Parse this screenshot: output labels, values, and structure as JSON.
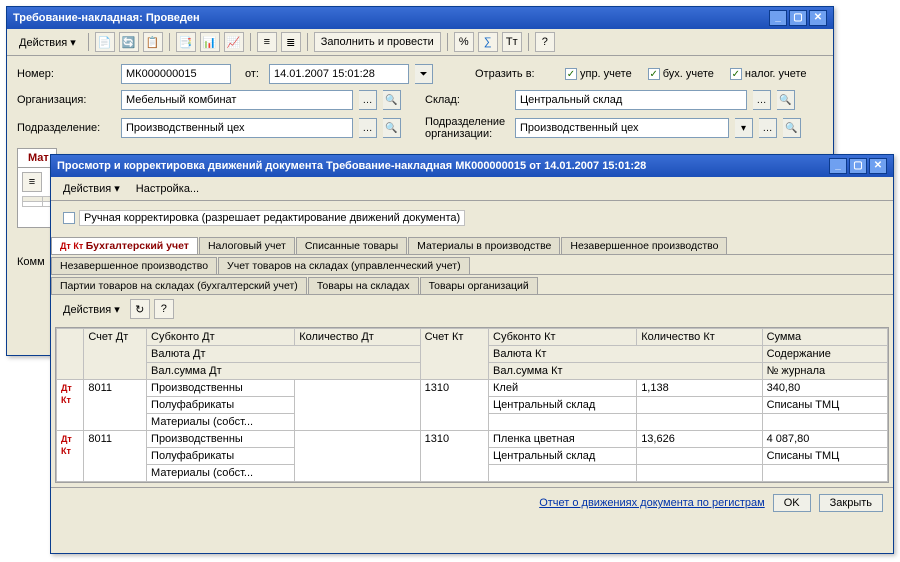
{
  "win1": {
    "title": "Требование-накладная: Проведен",
    "menu_actions": "Действия ▾",
    "btn_fill": "Заполнить и провести",
    "form": {
      "number_label": "Номер:",
      "number_value": "МК000000015",
      "from_label": "от:",
      "date_value": "14.01.2007 15:01:28",
      "org_label": "Организация:",
      "org_value": "Мебельный комбинат",
      "podr_label": "Подразделение:",
      "podr_value": "Производственный цех",
      "reflect_label": "Отразить в:",
      "chk_upr": "упр. учете",
      "chk_buh": "бух. учете",
      "chk_nal": "налог. учете",
      "sklad_label": "Склад:",
      "sklad_value": "Центральный склад",
      "podr_org_label": "Подразделение организации:",
      "podr_org_value": "Производственный цех"
    },
    "tab_mat": "Мат",
    "komm_label": "Комм"
  },
  "win2": {
    "title": "Просмотр и корректировка движений документа Требование-накладная МК000000015 от 14.01.2007 15:01:28",
    "menu_actions": "Действия ▾",
    "menu_settings": "Настройка...",
    "manual_label": "Ручная корректировка (разрешает редактирование движений документа)",
    "tabs_row1": [
      "Бухгалтерский учет",
      "Налоговый учет",
      "Списанные товары",
      "Материалы в производстве",
      "Незавершенное производство"
    ],
    "tabs_row2": [
      "Незавершенное производство",
      "Учет товаров на складах (управленческий учет)"
    ],
    "tabs_row3": [
      "Партии товаров на складах (бухгалтерский учет)",
      "Товары на складах",
      "Товары организаций"
    ],
    "grid_actions": "Действия ▾",
    "headers": {
      "icon": "",
      "schetDt": "Счет Дт",
      "subkDt": "Субконто Дт",
      "valDt": "Валюта Дт",
      "valsumDt": "Вал.сумма Дт",
      "kolDt": "Количество Дт",
      "schetKt": "Счет Кт",
      "subkKt": "Субконто Кт",
      "valKt": "Валюта Кт",
      "valsumKt": "Вал.сумма Кт",
      "kolKt": "Количество Кт",
      "summa": "Сумма",
      "soder": "Содержание",
      "jrn": "№ журнала"
    },
    "rows": [
      {
        "icon": "Дт Кт",
        "schetDt": "8011",
        "subkDt": [
          "Производственны",
          "Полуфабрикаты",
          "Материалы (собст..."
        ],
        "schetKt": "1310",
        "subkKt": [
          "Клей",
          "Центральный склад"
        ],
        "kolKt": "1,138",
        "summa": "340,80",
        "soder": "Списаны ТМЦ"
      },
      {
        "icon": "Дт Кт",
        "schetDt": "8011",
        "subkDt": [
          "Производственны",
          "Полуфабрикаты",
          "Материалы (собст..."
        ],
        "schetKt": "1310",
        "subkKt": [
          "Пленка цветная",
          "Центральный склад"
        ],
        "kolKt": "13,626",
        "summa": "4 087,80",
        "soder": "Списаны ТМЦ"
      }
    ],
    "report_link": "Отчет о движениях документа по регистрам",
    "ok": "OK",
    "close": "Закрыть"
  }
}
